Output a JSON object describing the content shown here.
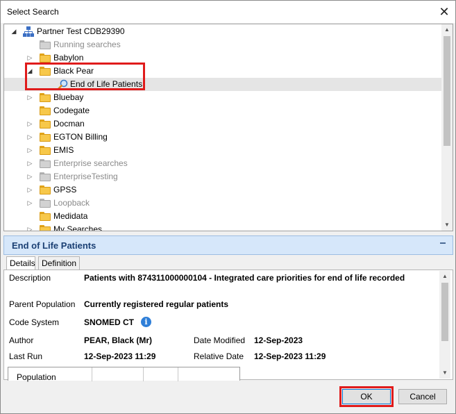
{
  "window": {
    "title": "Select Search"
  },
  "tree": {
    "root": {
      "label": "Partner Test CDB29390",
      "icon": "org-icon"
    },
    "items": [
      {
        "label": "Running searches",
        "muted": true
      },
      {
        "label": "Babylon",
        "muted": false
      },
      {
        "label": "Black Pear",
        "muted": false,
        "expanded": true
      },
      {
        "label": "End of Life Patients",
        "muted": false,
        "selected": true,
        "icon": "search-icon"
      },
      {
        "label": "Bluebay",
        "muted": false
      },
      {
        "label": "Codegate",
        "muted": false
      },
      {
        "label": "Docman",
        "muted": false
      },
      {
        "label": "EGTON Billing",
        "muted": false
      },
      {
        "label": "EMIS",
        "muted": false
      },
      {
        "label": "Enterprise searches",
        "muted": true
      },
      {
        "label": "EnterpriseTesting",
        "muted": true
      },
      {
        "label": "GPSS",
        "muted": false
      },
      {
        "label": "Loopback",
        "muted": true
      },
      {
        "label": "Medidata",
        "muted": false
      },
      {
        "label": "My Searches",
        "muted": false
      }
    ]
  },
  "details": {
    "title": "End of Life Patients",
    "tabs": [
      "Details",
      "Definition"
    ],
    "fields": {
      "description_label": "Description",
      "description_value": "Patients with 874311000000104 - Integrated care priorities for end of life recorded",
      "parent_label": "Parent Population",
      "parent_value": "Currently registered regular patients",
      "code_system_label": "Code System",
      "code_system_value": "SNOMED CT",
      "author_label": "Author",
      "author_value": "PEAR, Black (Mr)",
      "date_modified_label": "Date Modified",
      "date_modified_value": "12-Sep-2023",
      "last_run_label": "Last Run",
      "last_run_value": "12-Sep-2023 11:29",
      "relative_date_label": "Relative Date",
      "relative_date_value": "12-Sep-2023 11:29"
    },
    "population_header": "Population"
  },
  "buttons": {
    "ok": "OK",
    "cancel": "Cancel"
  },
  "colors": {
    "highlight": "#e01b1b",
    "header_bg": "#d6e7fa",
    "folder": "#f7c84a"
  }
}
